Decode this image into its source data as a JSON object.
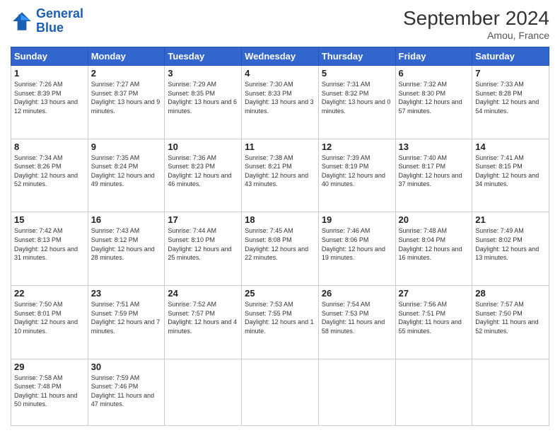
{
  "header": {
    "logo_line1": "General",
    "logo_line2": "Blue",
    "month_title": "September 2024",
    "location": "Amou, France"
  },
  "weekdays": [
    "Sunday",
    "Monday",
    "Tuesday",
    "Wednesday",
    "Thursday",
    "Friday",
    "Saturday"
  ],
  "weeks": [
    [
      {
        "day": "1",
        "sunrise": "7:26 AM",
        "sunset": "8:39 PM",
        "daylight": "13 hours and 12 minutes."
      },
      {
        "day": "2",
        "sunrise": "7:27 AM",
        "sunset": "8:37 PM",
        "daylight": "13 hours and 9 minutes."
      },
      {
        "day": "3",
        "sunrise": "7:29 AM",
        "sunset": "8:35 PM",
        "daylight": "13 hours and 6 minutes."
      },
      {
        "day": "4",
        "sunrise": "7:30 AM",
        "sunset": "8:33 PM",
        "daylight": "13 hours and 3 minutes."
      },
      {
        "day": "5",
        "sunrise": "7:31 AM",
        "sunset": "8:32 PM",
        "daylight": "13 hours and 0 minutes."
      },
      {
        "day": "6",
        "sunrise": "7:32 AM",
        "sunset": "8:30 PM",
        "daylight": "12 hours and 57 minutes."
      },
      {
        "day": "7",
        "sunrise": "7:33 AM",
        "sunset": "8:28 PM",
        "daylight": "12 hours and 54 minutes."
      }
    ],
    [
      {
        "day": "8",
        "sunrise": "7:34 AM",
        "sunset": "8:26 PM",
        "daylight": "12 hours and 52 minutes."
      },
      {
        "day": "9",
        "sunrise": "7:35 AM",
        "sunset": "8:24 PM",
        "daylight": "12 hours and 49 minutes."
      },
      {
        "day": "10",
        "sunrise": "7:36 AM",
        "sunset": "8:23 PM",
        "daylight": "12 hours and 46 minutes."
      },
      {
        "day": "11",
        "sunrise": "7:38 AM",
        "sunset": "8:21 PM",
        "daylight": "12 hours and 43 minutes."
      },
      {
        "day": "12",
        "sunrise": "7:39 AM",
        "sunset": "8:19 PM",
        "daylight": "12 hours and 40 minutes."
      },
      {
        "day": "13",
        "sunrise": "7:40 AM",
        "sunset": "8:17 PM",
        "daylight": "12 hours and 37 minutes."
      },
      {
        "day": "14",
        "sunrise": "7:41 AM",
        "sunset": "8:15 PM",
        "daylight": "12 hours and 34 minutes."
      }
    ],
    [
      {
        "day": "15",
        "sunrise": "7:42 AM",
        "sunset": "8:13 PM",
        "daylight": "12 hours and 31 minutes."
      },
      {
        "day": "16",
        "sunrise": "7:43 AM",
        "sunset": "8:12 PM",
        "daylight": "12 hours and 28 minutes."
      },
      {
        "day": "17",
        "sunrise": "7:44 AM",
        "sunset": "8:10 PM",
        "daylight": "12 hours and 25 minutes."
      },
      {
        "day": "18",
        "sunrise": "7:45 AM",
        "sunset": "8:08 PM",
        "daylight": "12 hours and 22 minutes."
      },
      {
        "day": "19",
        "sunrise": "7:46 AM",
        "sunset": "8:06 PM",
        "daylight": "12 hours and 19 minutes."
      },
      {
        "day": "20",
        "sunrise": "7:48 AM",
        "sunset": "8:04 PM",
        "daylight": "12 hours and 16 minutes."
      },
      {
        "day": "21",
        "sunrise": "7:49 AM",
        "sunset": "8:02 PM",
        "daylight": "12 hours and 13 minutes."
      }
    ],
    [
      {
        "day": "22",
        "sunrise": "7:50 AM",
        "sunset": "8:01 PM",
        "daylight": "12 hours and 10 minutes."
      },
      {
        "day": "23",
        "sunrise": "7:51 AM",
        "sunset": "7:59 PM",
        "daylight": "12 hours and 7 minutes."
      },
      {
        "day": "24",
        "sunrise": "7:52 AM",
        "sunset": "7:57 PM",
        "daylight": "12 hours and 4 minutes."
      },
      {
        "day": "25",
        "sunrise": "7:53 AM",
        "sunset": "7:55 PM",
        "daylight": "12 hours and 1 minute."
      },
      {
        "day": "26",
        "sunrise": "7:54 AM",
        "sunset": "7:53 PM",
        "daylight": "11 hours and 58 minutes."
      },
      {
        "day": "27",
        "sunrise": "7:56 AM",
        "sunset": "7:51 PM",
        "daylight": "11 hours and 55 minutes."
      },
      {
        "day": "28",
        "sunrise": "7:57 AM",
        "sunset": "7:50 PM",
        "daylight": "11 hours and 52 minutes."
      }
    ],
    [
      {
        "day": "29",
        "sunrise": "7:58 AM",
        "sunset": "7:48 PM",
        "daylight": "11 hours and 50 minutes."
      },
      {
        "day": "30",
        "sunrise": "7:59 AM",
        "sunset": "7:46 PM",
        "daylight": "11 hours and 47 minutes."
      },
      null,
      null,
      null,
      null,
      null
    ]
  ]
}
